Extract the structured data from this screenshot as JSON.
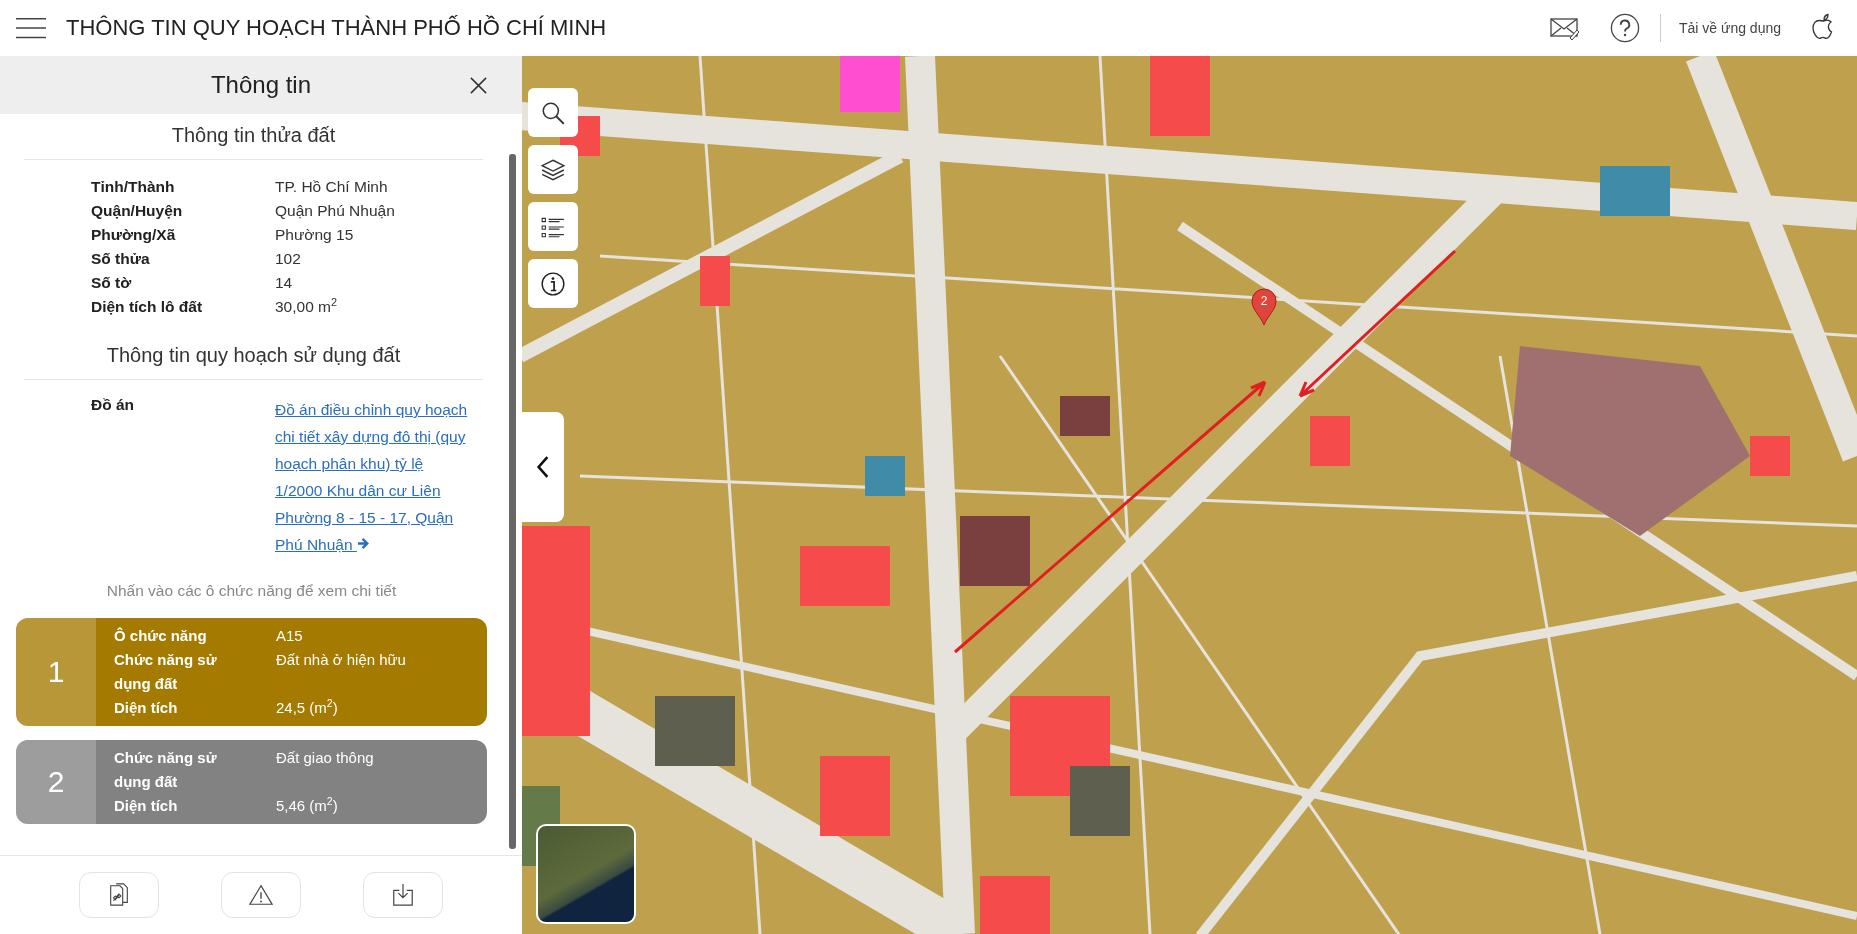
{
  "header": {
    "title": "THÔNG TIN QUY HOẠCH THÀNH PHỐ HỒ CHÍ MINH",
    "download_label": "Tải về ứng dụng"
  },
  "panel": {
    "title": "Thông tin",
    "parcel_section": {
      "title": "Thông tin thửa đất",
      "rows": [
        {
          "label": "Tỉnh/Thành",
          "value": "TP. Hồ Chí Minh"
        },
        {
          "label": "Quận/Huyện",
          "value": "Quận Phú Nhuận"
        },
        {
          "label": "Phường/Xã",
          "value": "Phường 15"
        },
        {
          "label": "Số thửa",
          "value": "102"
        },
        {
          "label": "Số tờ",
          "value": "14"
        },
        {
          "label": "Diện tích lô đất",
          "value": "30,00 m$^{2}$"
        }
      ]
    },
    "planning_section": {
      "title": "Thông tin quy hoạch sử dụng đất",
      "project_label": "Đồ án",
      "project_link": "Đồ án điều chỉnh quy hoạch chi tiết xây dựng đô thị (quy hoạch phân khu) tỷ lệ 1/2000 Khu dân cư Liên Phường 8 - 15 - 17, Quận Phú Nhuận"
    },
    "hint": "Nhấn vào các ô chức năng để xem chi tiết",
    "zones": [
      {
        "number": "1",
        "color": "#a57a00",
        "rows": [
          {
            "label": "Ô chức năng",
            "value": "A15"
          },
          {
            "label": "Chức năng sử dụng đất",
            "value": "Đất nhà ở hiện hữu"
          },
          {
            "label": "Diện tích",
            "value": "24,5 (m$^{2}$)"
          }
        ]
      },
      {
        "number": "2",
        "color": "#828282",
        "rows": [
          {
            "label": "Chức năng sử dụng đất",
            "value": "Đất giao thông"
          },
          {
            "label": "Diện tích",
            "value": "5,46 (m$^{2}$)"
          }
        ]
      }
    ]
  },
  "map": {
    "marker_label": "2"
  }
}
